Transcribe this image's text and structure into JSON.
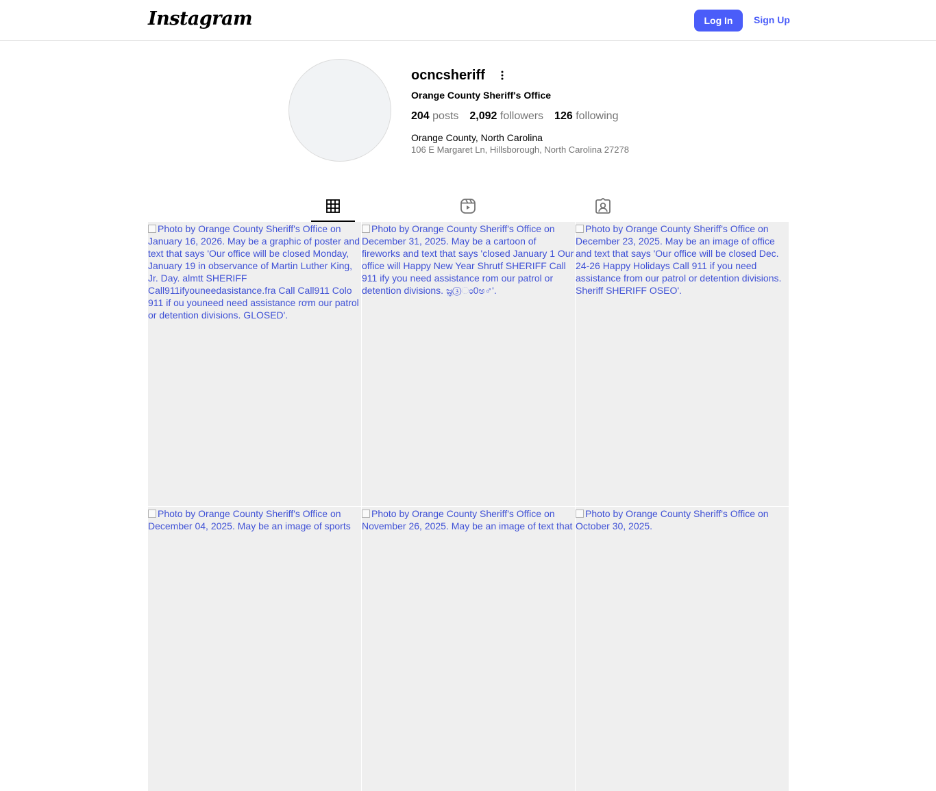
{
  "header": {
    "logo_text": "Instagram",
    "login_label": "Log In",
    "signup_label": "Sign Up"
  },
  "profile": {
    "username": "ocncsheriff",
    "full_name": "Orange County Sheriff's Office",
    "posts_count": "204",
    "posts_label": "posts",
    "followers_count": "2,092",
    "followers_label": "followers",
    "following_count": "126",
    "following_label": "following",
    "location": "Orange County, North Carolina",
    "address": "106 E Margaret Ln, Hillsborough, North Carolina 27278"
  },
  "tabs": [
    {
      "icon": "grid-icon",
      "active": true
    },
    {
      "icon": "reels-icon",
      "active": false
    },
    {
      "icon": "tagged-icon",
      "active": false
    }
  ],
  "posts": [
    {
      "alt": "Photo by Orange County Sheriff's Office on January 16, 2026. May be a graphic of poster and text that says 'Our office will be closed Monday, January 19 in observance of Martin Luther King, Jr. Day. almtt SHERIFF Call911ifyouneedasistance.fra Call Call911 Colo 911 if ou youneed need assistance rơm our patrol or detention divisions. GLOSED'."
    },
    {
      "alt": "Photo by Orange County Sheriff's Office on December 31, 2025. May be a cartoon of fireworks and text that says 'closed January 1 Our office will Happy New Year Shrutf SHERIFF Call 911 ify you need assistance rom our patrol or detention divisions. ಜ್ಞ③ಂ0ಅ♂'."
    },
    {
      "alt": "Photo by Orange County Sheriff's Office on December 23, 2025. May be an image of office and text that says 'Our office will be closed Dec. 24-26 Happy Holidays Call 911 if you need assistance from our patrol or detention divisions. Sheriff SHERIFF OSEO'."
    },
    {
      "alt": "Photo by Orange County Sheriff's Office on December 04, 2025. May be an image of sports"
    },
    {
      "alt": "Photo by Orange County Sheriff's Office on November 26, 2025. May be an image of text that"
    },
    {
      "alt": "Photo by Orange County Sheriff's Office on October 30, 2025."
    }
  ]
}
